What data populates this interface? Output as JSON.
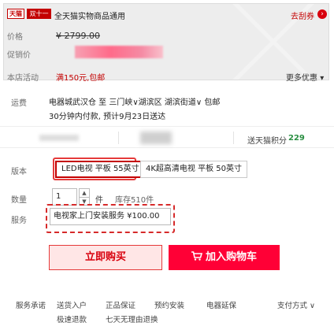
{
  "promo": {
    "badge_tmall": "天猫",
    "badge_tag": "双十一",
    "title": "全天猫实物商品通用",
    "coupon_link": "去刮券",
    "coupon_arrow": "›",
    "price_label": "价格",
    "original_price": "¥ 2799.00",
    "promo_price_label": "促销价",
    "store_activity_label": "本店活动",
    "store_activity": "满150元,包邮",
    "more_deals": "更多优惠"
  },
  "shipping": {
    "label": "运费",
    "line1": "电器城武汉仓  至  三门峡∨湖滨区  湖滨街道∨ 包邮",
    "line2": "30分钟内付款, 预计9月23日送达"
  },
  "points": {
    "label": "送天猫积分",
    "value": "229"
  },
  "version": {
    "label": "版本",
    "options": [
      {
        "label": "LED电视 平板 55英寸",
        "selected": true
      },
      {
        "label": "4K超高清电视 平板 50英寸",
        "selected": false
      }
    ]
  },
  "quantity": {
    "label": "数量",
    "value": "1",
    "unit": "件",
    "stock": "库存510件",
    "up": "▲",
    "down": "▼"
  },
  "service": {
    "label": "服务",
    "option": "电视家上门安装服务   ¥100.00"
  },
  "actions": {
    "buy_now": "立即购买",
    "add_to_cart": "加入购物车",
    "cart_icon": "cart-icon"
  },
  "footer": {
    "items": [
      "服务承诺",
      "送货入户",
      "正品保证",
      "预约安装",
      "电器延保",
      "支付方式 ∨",
      "极速退款",
      "七天无理由退换"
    ]
  },
  "colors": {
    "brand_red": "#ff0036",
    "accent_red": "#c40000",
    "points_green": "#2b8f43"
  }
}
